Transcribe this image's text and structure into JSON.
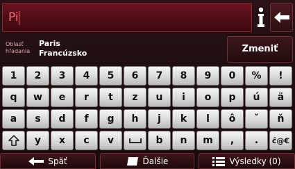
{
  "search": {
    "value": "Pi"
  },
  "area": {
    "label": "Oblasť hľadania",
    "city": "Paris",
    "country": "Francúzsko",
    "change_label": "Zmeniť"
  },
  "keyboard": {
    "rows": [
      [
        "1",
        "2",
        "3",
        "4",
        "5",
        "6",
        "7",
        "8",
        "9",
        "0",
        "%",
        "!"
      ],
      [
        "q",
        "w",
        "e",
        "r",
        "t",
        "z",
        "u",
        "i",
        "o",
        "p",
        "ú",
        "ä"
      ],
      [
        "a",
        "s",
        "d",
        "f",
        "g",
        "h",
        "j",
        "k",
        "l",
        "ô",
        "ˇ",
        "ň"
      ],
      [
        "y",
        "x",
        "c",
        "v",
        "b",
        "n",
        "m",
        ",",
        "."
      ],
      [
        "ĉ@€"
      ]
    ]
  },
  "bottom": {
    "back_label": "Späť",
    "next_label": "Ďalšie",
    "results_label": "Výsledky (0)"
  },
  "colors": {
    "accent": "#f06a79",
    "background": "#1a0d0f",
    "key": "#e6e6e6"
  },
  "icons": [
    "info-icon",
    "backspace-icon",
    "shift-icon",
    "space-icon",
    "back-arrow-icon",
    "next-icon",
    "list-icon"
  ]
}
